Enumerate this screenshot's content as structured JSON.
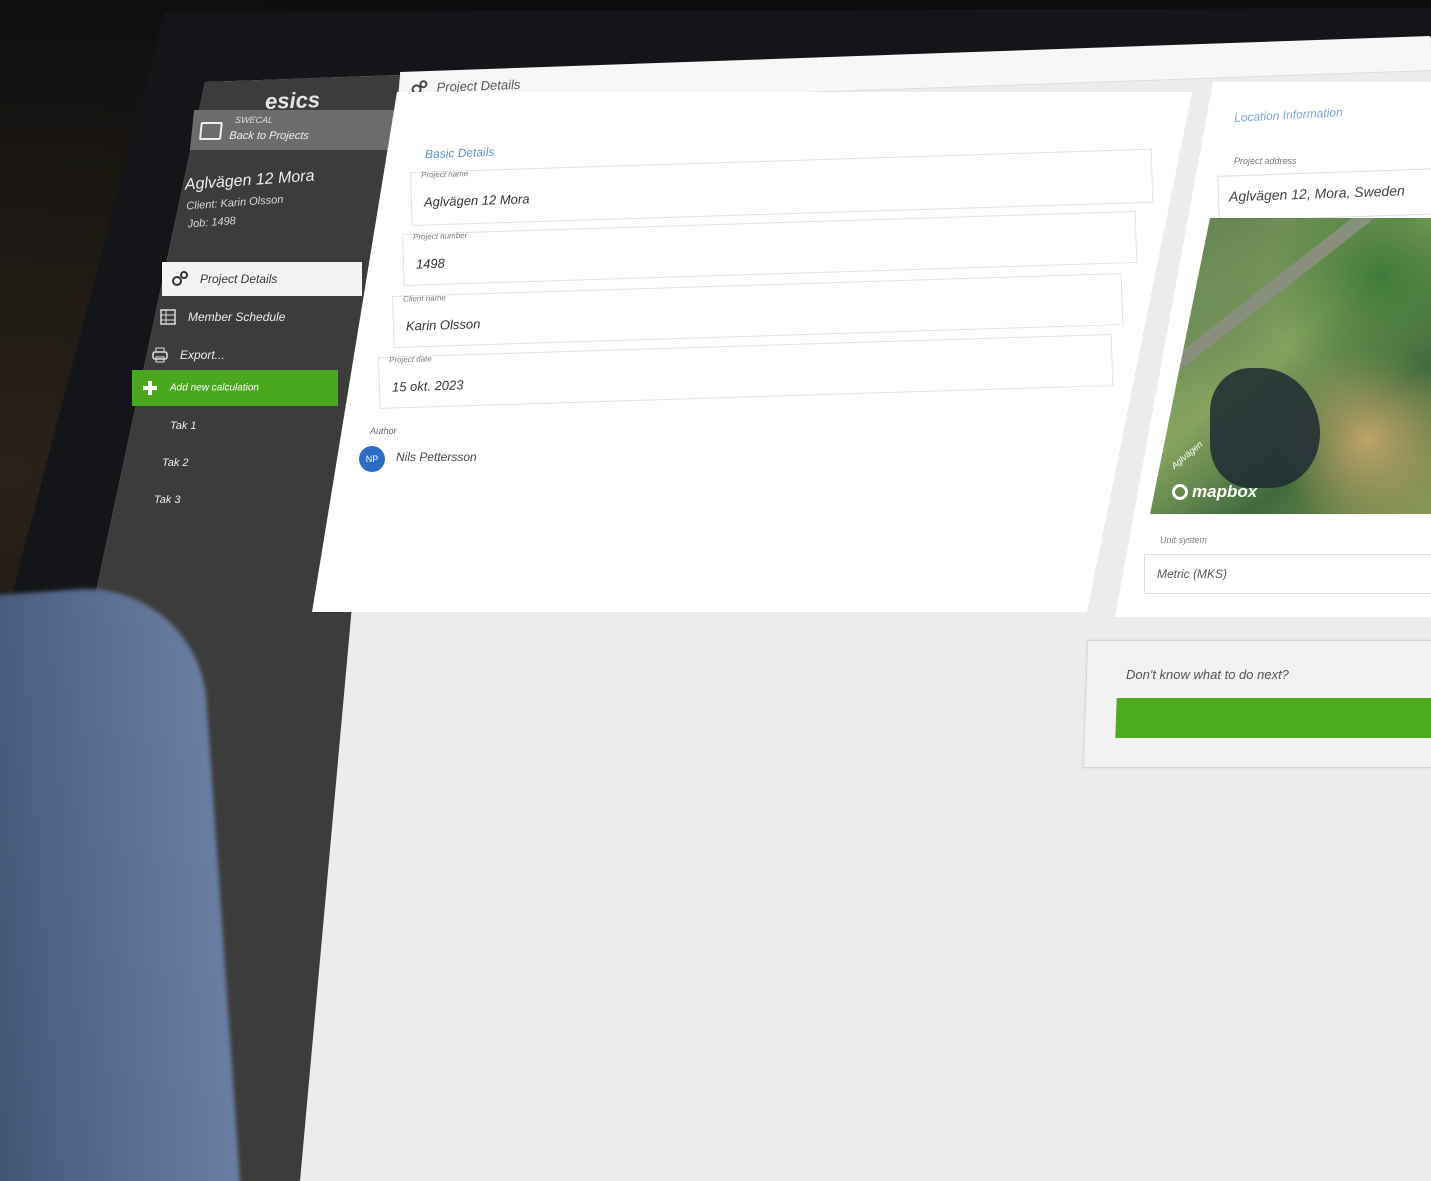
{
  "app": {
    "logo": "esics"
  },
  "topbar": {
    "title": "Project Details"
  },
  "sidebar": {
    "back_small": "SWECAL",
    "back_label": "Back to Projects",
    "project_title": "Aglvägen 12 Mora",
    "client": "Client: Karin Olsson",
    "job": "Job: 1498",
    "menu": [
      {
        "label": "Project Details",
        "icon": "gears-icon"
      },
      {
        "label": "Member Schedule",
        "icon": "grid-icon"
      },
      {
        "label": "Export...",
        "icon": "printer-icon"
      },
      {
        "label": "Add new calculation",
        "icon": "plus-icon"
      }
    ],
    "calculations": [
      "Tak 1",
      "Tak 2",
      "Tak 3"
    ]
  },
  "basic": {
    "title": "Basic Details",
    "fields": [
      {
        "label": "Project name",
        "value": "Aglvägen 12 Mora"
      },
      {
        "label": "Project number",
        "value": "1498"
      },
      {
        "label": "Client name",
        "value": "Karin Olsson"
      },
      {
        "label": "Project date",
        "value": "15 okt. 2023"
      }
    ],
    "author_label": "Author",
    "author_initials": "NP",
    "author_name": "Nils Pettersson"
  },
  "location": {
    "title": "Location Information",
    "address_label": "Project address",
    "address": "Aglvägen 12, Mora, Sweden",
    "map_brand": "mapbox",
    "map_road_label": "Aglvägen",
    "unit_label": "Unit system",
    "unit_value": "Metric (MKS)"
  },
  "help": {
    "text": "Don't know what to do next?"
  },
  "colors": {
    "accent_green": "#4aa81f",
    "sidebar": "#3b3c3b",
    "link_blue": "#5a8ec9"
  }
}
